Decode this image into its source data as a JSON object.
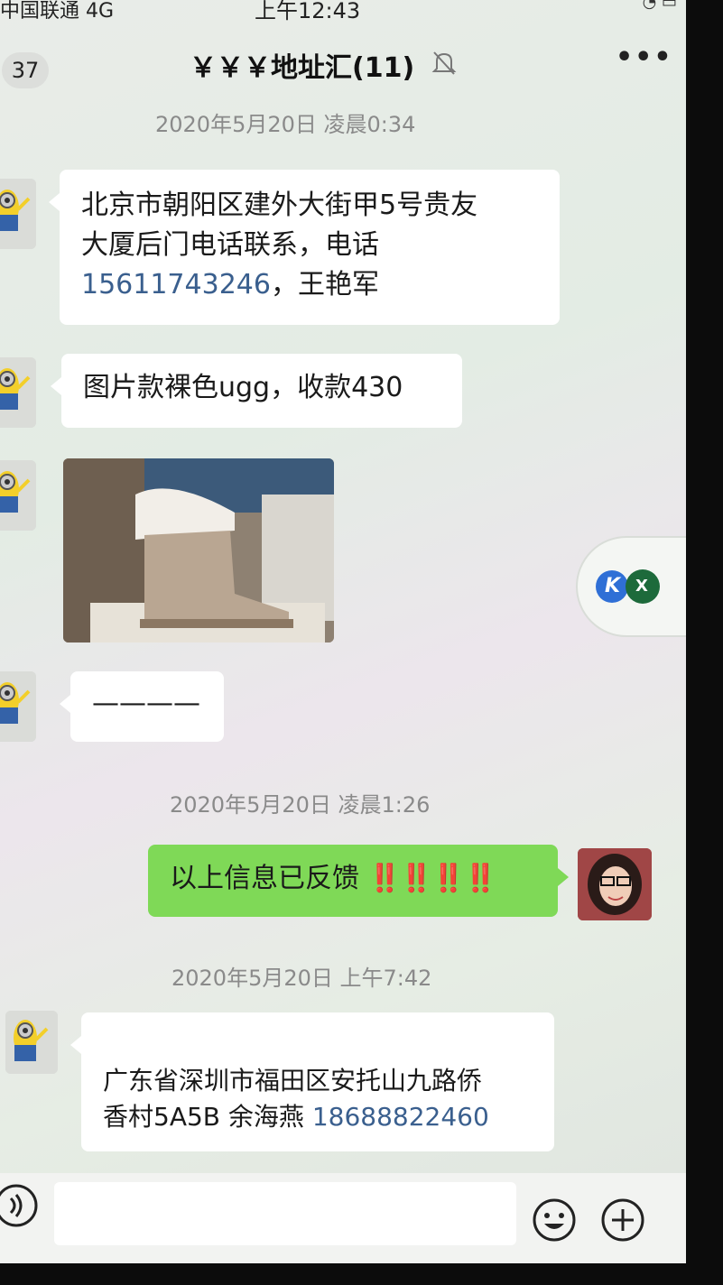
{
  "status_bar": {
    "carrier": "中国联通  4G",
    "time": "上午12:43"
  },
  "nav": {
    "back_count": "37",
    "title": "￥￥￥地址汇(11)",
    "more": "•••"
  },
  "messages": {
    "ts1": "2020年5月20日 凌晨0:34",
    "m1_line1": "北京市朝阳区建外大街甲5号贵友",
    "m1_line2": "大厦后门电话联系，电话",
    "m1_phone": "15611743246",
    "m1_name": "，王艳军",
    "m2": "图片款裸色ugg，收款430",
    "m4": "————",
    "ts2": "2020年5月20日 凌晨1:26",
    "m5": "以上信息已反馈",
    "m5_bangs": "‼️‼️‼️‼️",
    "ts3": "2020年5月20日 上午7:42",
    "m6_line1": "广东省深圳市福田区安托山九路侨",
    "m6_line2": "香村5A5B 余海燕",
    "m6_phone": "18688822460"
  },
  "float_widget": {
    "badge_k": "K",
    "badge_x": "X"
  },
  "colors": {
    "self_bubble": "#7fd957",
    "link_phone": "#3a5f8e",
    "exclamation": "#d01010"
  },
  "icons": [
    "mute-icon",
    "more-icon",
    "voice-icon",
    "emoji-icon",
    "plus-icon"
  ]
}
